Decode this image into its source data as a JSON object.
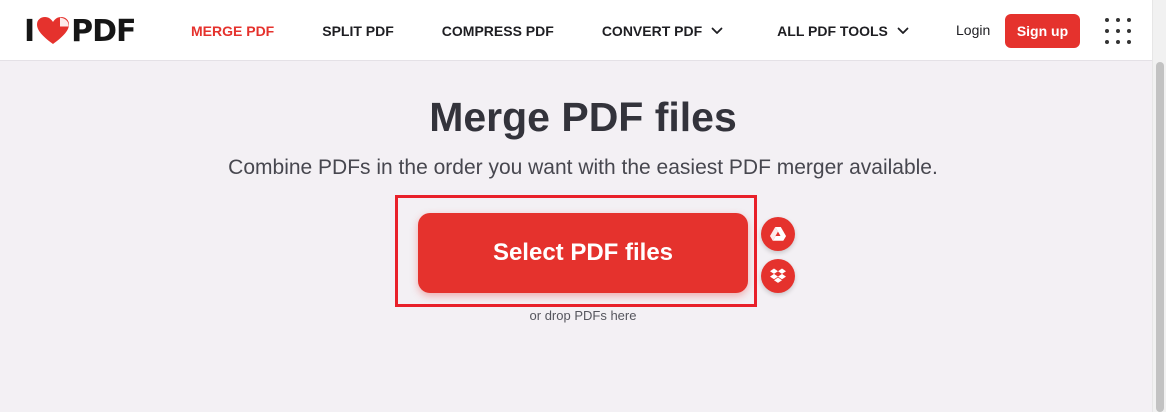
{
  "header": {
    "logo": {
      "left_text": "I",
      "right_text": "PDF",
      "icon": "heart-icon",
      "brand_color": "#e5322d"
    },
    "nav": [
      {
        "label": "MERGE PDF",
        "active": true
      },
      {
        "label": "SPLIT PDF",
        "active": false
      },
      {
        "label": "COMPRESS PDF",
        "active": false
      },
      {
        "label": "CONVERT PDF",
        "active": false,
        "dropdown": true
      },
      {
        "label": "ALL PDF TOOLS",
        "active": false,
        "dropdown": true
      }
    ],
    "login_label": "Login",
    "signup_label": "Sign up",
    "apps_icon": "grid-dots-icon"
  },
  "main": {
    "title": "Merge PDF files",
    "subtitle": "Combine PDFs in the order you want with the easiest PDF merger available.",
    "select_button_label": "Select PDF files",
    "cloud_sources": [
      {
        "icon": "google-drive-icon"
      },
      {
        "icon": "dropbox-icon"
      }
    ],
    "drop_hint": "or drop PDFs here"
  },
  "colors": {
    "accent": "#e5322d",
    "highlight_frame": "#e8202a",
    "background": "#f3f0f4",
    "text_dark": "#33333b"
  }
}
